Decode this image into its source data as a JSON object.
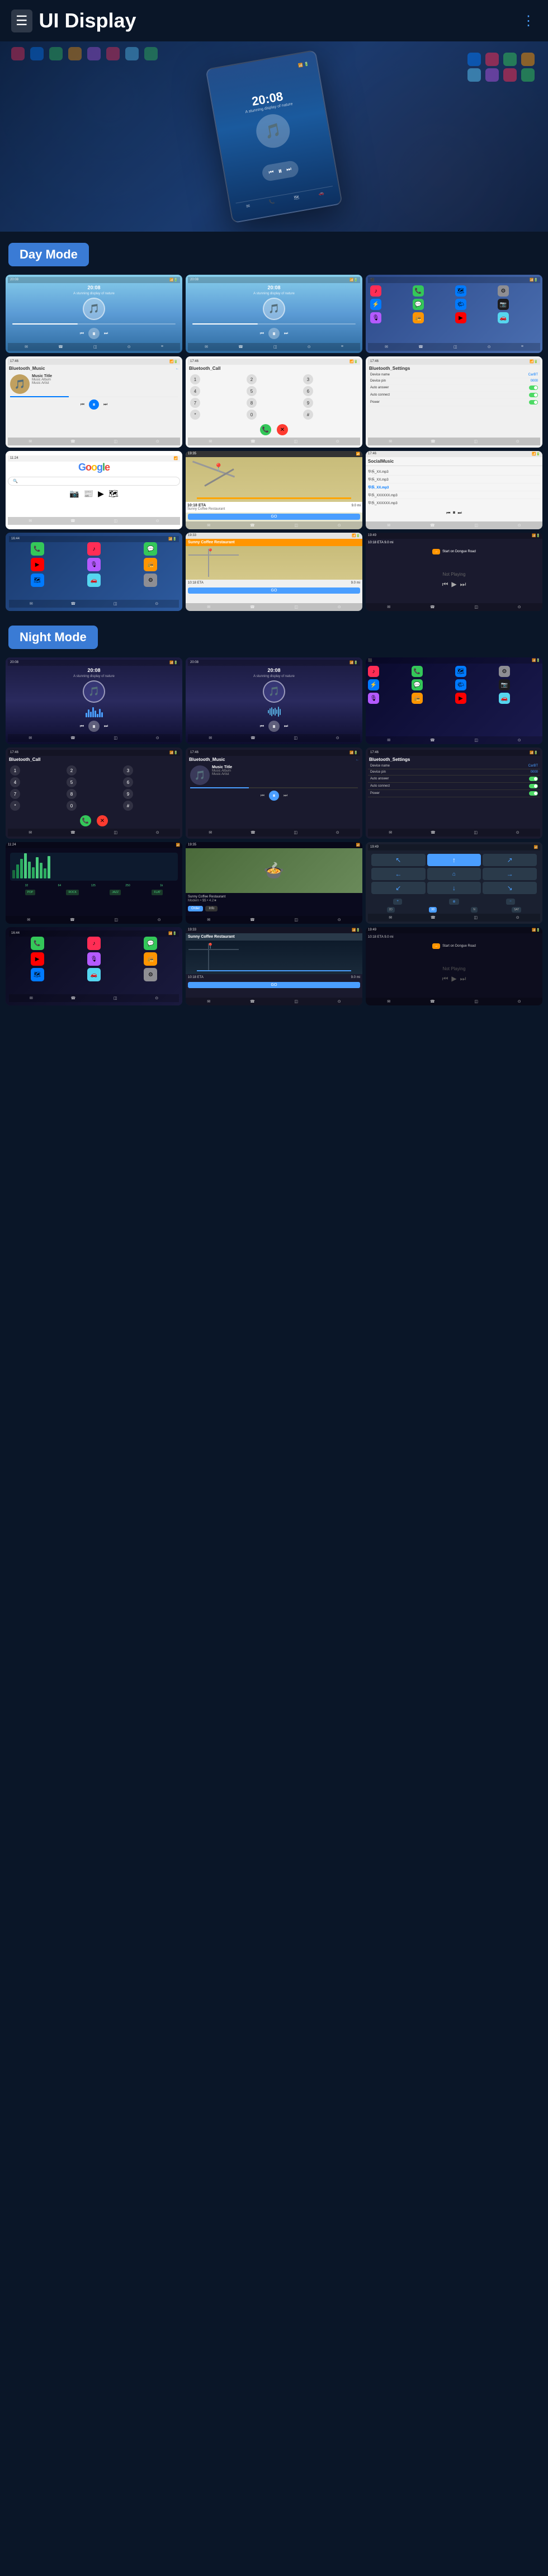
{
  "header": {
    "title": "UI Display",
    "menu_icon": "☰",
    "dots_icon": "⋮"
  },
  "day_mode": {
    "label": "Day Mode"
  },
  "night_mode": {
    "label": "Night Mode"
  },
  "screens": {
    "music_title": "Music Title",
    "music_album": "Music Album",
    "music_artist": "Music Artist",
    "time_display": "20:08",
    "bt_music": "Bluetooth_Music",
    "bt_call": "Bluetooth_Call",
    "bt_settings": "Bluetooth_Settings",
    "device_name_label": "Device name",
    "device_name_val": "CarBT",
    "device_pin_label": "Device pin",
    "device_pin_val": "0000",
    "auto_answer_label": "Auto answer",
    "auto_connect_label": "Auto connect",
    "power_label": "Power",
    "google_text": "Google",
    "sunny_coffee": "Sunny Coffee Restaurant",
    "eta_label": "10:18 ETA",
    "eta_val": "9.0 mi",
    "go_label": "GO",
    "not_playing": "Not Playing",
    "dongue_road": "Start on Dongue Road",
    "social_music": "SocialMusic",
    "local_music": "本地音乐",
    "night_music_title": "Music Title",
    "night_music_album": "Music Album",
    "night_music_artist": "Music Artist"
  },
  "app_icons": {
    "music": "♪",
    "phone": "📞",
    "navigation": "🗺",
    "message": "💬",
    "bluetooth": "⚡",
    "settings": "⚙",
    "camera": "📷",
    "weather": "🌤",
    "podcast": "🎙",
    "radio": "📻",
    "youtube": "▶",
    "waze": "🚗"
  }
}
